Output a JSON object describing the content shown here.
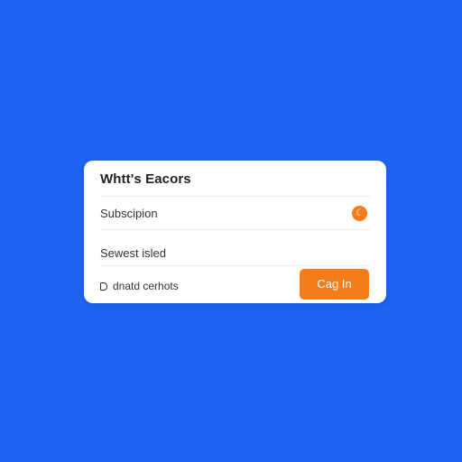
{
  "dialog": {
    "title": "Whtt's Eacors",
    "rows": [
      {
        "label": "Subscipion",
        "toggle_icon": "toggle-icon",
        "toggle_glyph": "☾",
        "accent": "#f57c1b"
      },
      {
        "label": "Sewest isled"
      }
    ],
    "checkbox": {
      "label": "dnatd cerhots",
      "icon": "checkbox-icon"
    },
    "primary_button": {
      "label": "Cag In",
      "color": "#f57c1b"
    }
  },
  "background_color": "#1f63f2"
}
